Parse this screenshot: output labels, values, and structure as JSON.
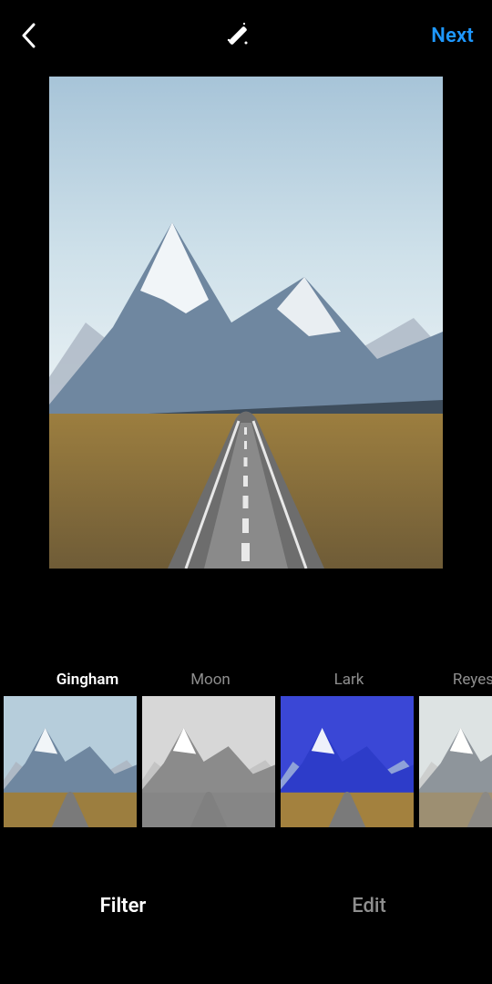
{
  "header": {
    "back_icon": "back",
    "magic_icon": "auto-enhance",
    "next_label": "Next"
  },
  "preview": {
    "applied_filter": "Gingham"
  },
  "filters": [
    {
      "name": "Gingham",
      "selected": true
    },
    {
      "name": "Moon",
      "selected": false
    },
    {
      "name": "Lark",
      "selected": false
    },
    {
      "name": "Reyes",
      "selected": false
    }
  ],
  "tabs": {
    "filter_label": "Filter",
    "edit_label": "Edit",
    "active": "Filter"
  },
  "colors": {
    "accent": "#1e98ff"
  }
}
